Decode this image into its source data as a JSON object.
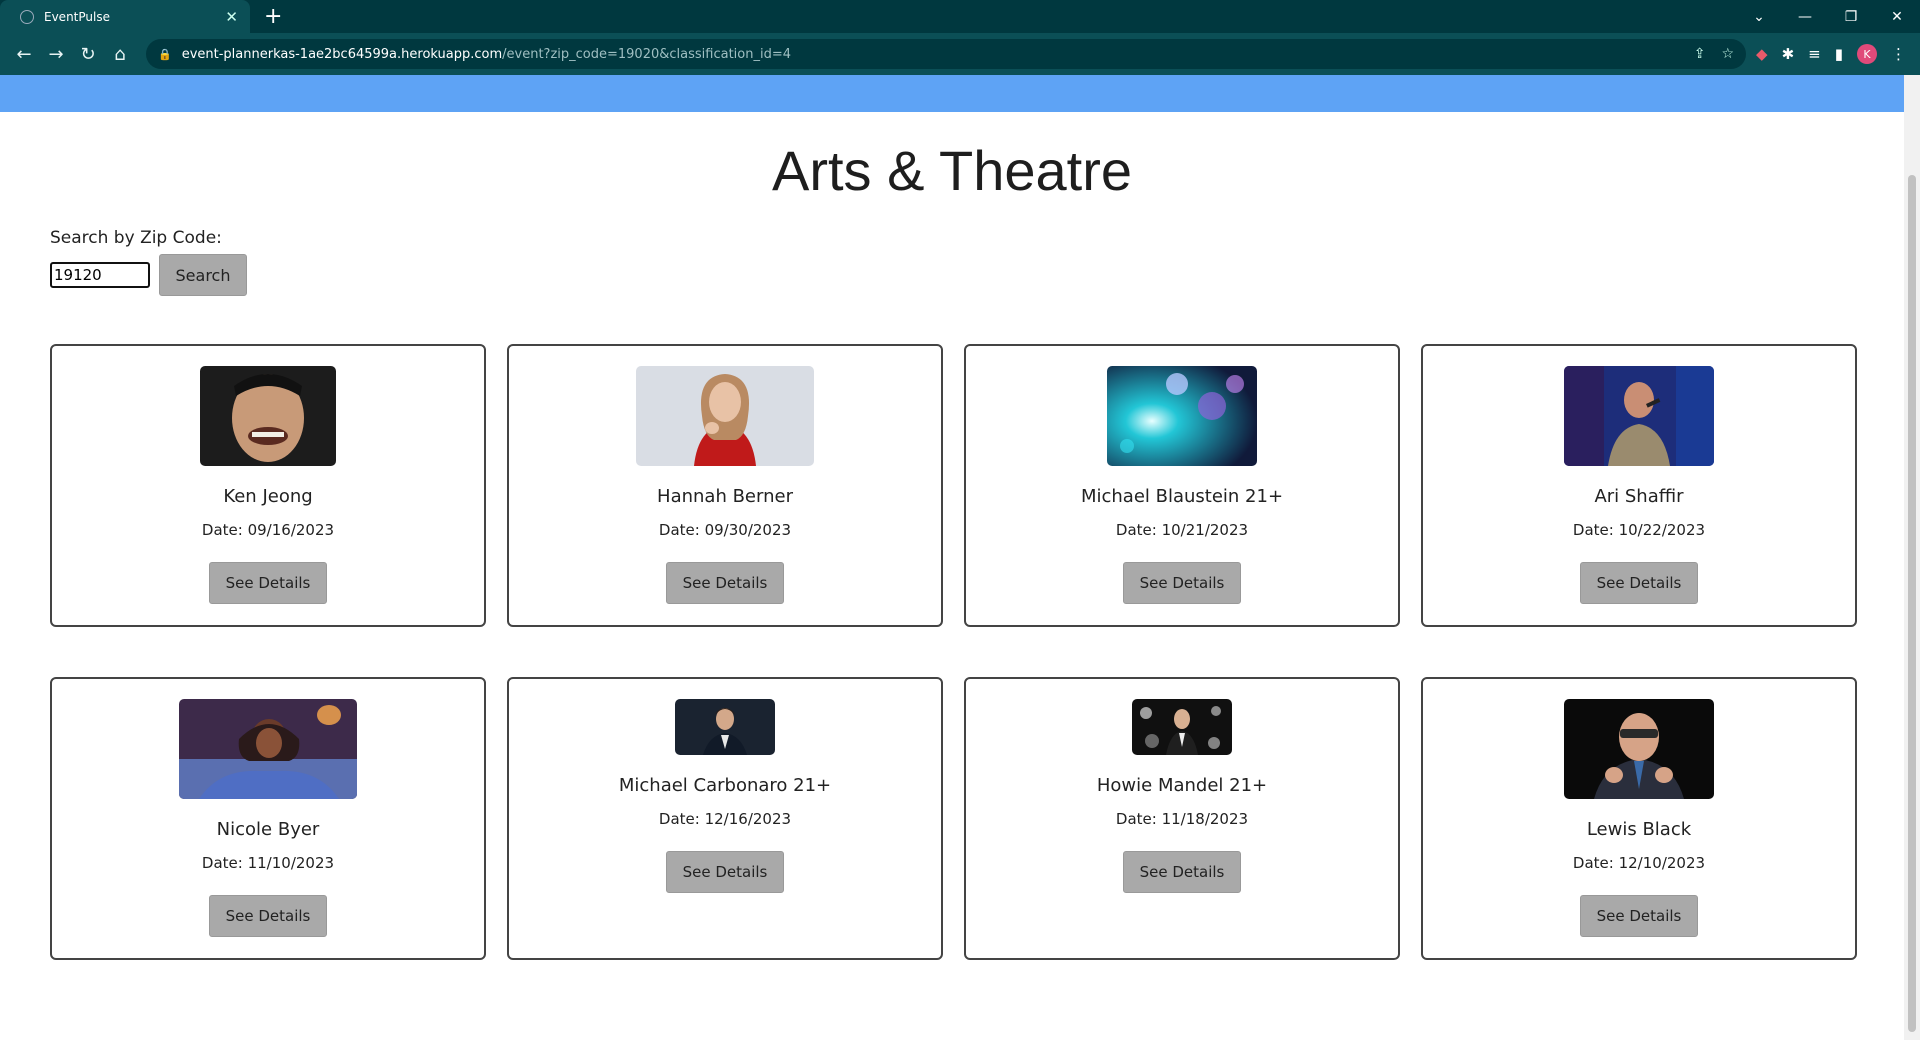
{
  "browser": {
    "tab_title": "EventPulse",
    "url_host": "event-plannerkas-1ae2bc64599a.herokuapp.com",
    "url_path": "/event?zip_code=19020&classification_id=4",
    "profile_initial": "K"
  },
  "page": {
    "title": "Arts & Theatre",
    "search_label": "Search by Zip Code:",
    "search_value": "19120",
    "search_button": "Search",
    "details_label": "See Details"
  },
  "events": [
    {
      "name": "Ken Jeong",
      "date": "Date: 09/16/2023"
    },
    {
      "name": "Hannah Berner",
      "date": "Date: 09/30/2023"
    },
    {
      "name": "Michael Blaustein 21+",
      "date": "Date: 10/21/2023"
    },
    {
      "name": "Ari Shaffir",
      "date": "Date: 10/22/2023"
    },
    {
      "name": "Nicole Byer",
      "date": "Date: 11/10/2023"
    },
    {
      "name": "Michael Carbonaro 21+",
      "date": "Date: 12/16/2023"
    },
    {
      "name": "Howie Mandel 21+",
      "date": "Date: 11/18/2023"
    },
    {
      "name": "Lewis Black",
      "date": "Date: 12/10/2023"
    }
  ],
  "colors": {
    "header_bar": "#5ea3f5",
    "button_bg": "#a9a9a9",
    "chrome_bg": "#0b4f56"
  }
}
